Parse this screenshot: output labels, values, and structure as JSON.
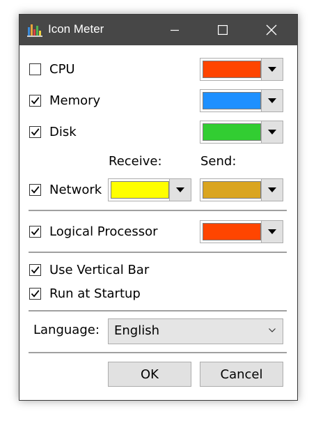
{
  "window": {
    "title": "Icon Meter",
    "controls": {
      "minimize": "minimize-icon",
      "maximize": "maximize-icon",
      "close": "close-icon"
    }
  },
  "metrics": {
    "cpu": {
      "label": "CPU",
      "checked": false,
      "color": "#ff4500"
    },
    "memory": {
      "label": "Memory",
      "checked": true,
      "color": "#1e90ff"
    },
    "disk": {
      "label": "Disk",
      "checked": true,
      "color": "#32cd32"
    },
    "network": {
      "label": "Network",
      "checked": true,
      "receive_label": "Receive:",
      "send_label": "Send:",
      "receive_color": "#ffff00",
      "send_color": "#daa520"
    },
    "logical_processor": {
      "label": "Logical Processor",
      "checked": true,
      "color": "#ff4500"
    }
  },
  "options": {
    "vertical_bar": {
      "label": "Use Vertical Bar",
      "checked": true
    },
    "startup": {
      "label": "Run at Startup",
      "checked": true
    }
  },
  "language": {
    "label": "Language:",
    "selected": "English"
  },
  "buttons": {
    "ok": "OK",
    "cancel": "Cancel"
  }
}
